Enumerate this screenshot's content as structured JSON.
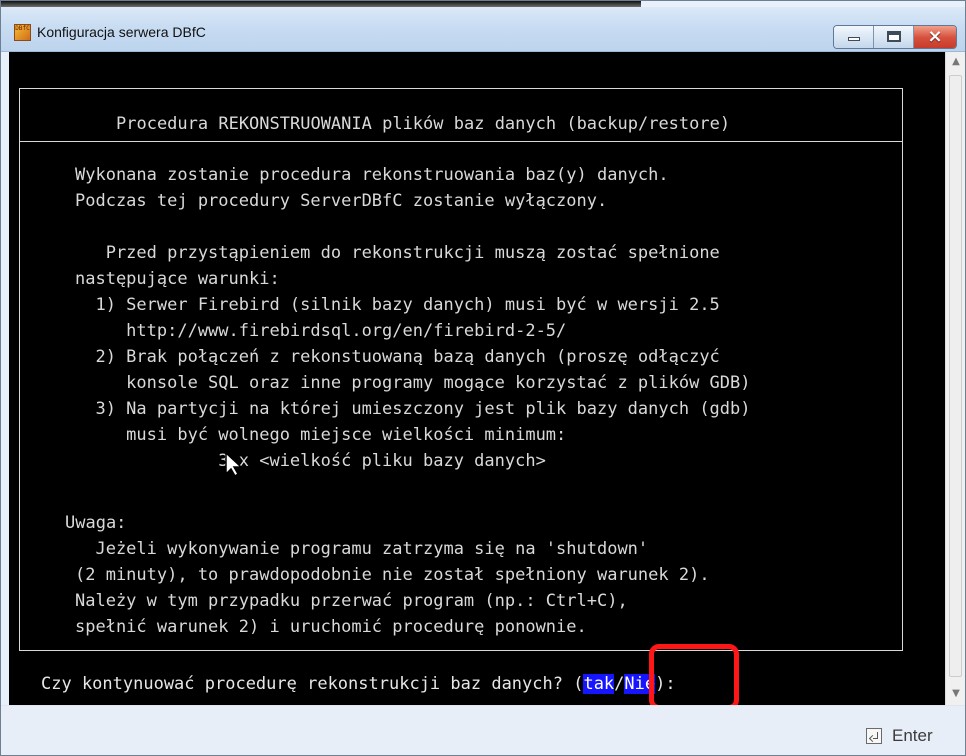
{
  "window": {
    "title": "Konfiguracja serwera DBfC",
    "app_icon_text": "DBfC",
    "icons": {
      "app": "dbfc-app-icon",
      "minimize": "minimize-icon",
      "maximize": "maximize-icon",
      "close": "close-icon",
      "enter": "enter-key-icon",
      "cursor": "mouse-pointer-icon"
    },
    "colors": {
      "console_background": "#000000",
      "console_text": "#d9d9d9",
      "choice_background": "#1515ff",
      "annotation": "#ff1616"
    }
  },
  "console": {
    "heading": "Procedura REKONSTRUOWANIA plików baz danych (backup/restore)",
    "lines": [
      "Wykonana zostanie procedura rekonstruowania baz(y) danych.",
      "Podczas tej procedury ServerDBfC zostanie wyłączony.",
      "",
      "   Przed przystąpieniem do rekonstrukcji muszą zostać spełnione",
      "następujące warunki:",
      "  1) Serwer Firebird (silnik bazy danych) musi być w wersji 2.5",
      "     http://www.firebirdsql.org/en/firebird-2-5/",
      "  2) Brak połączeń z rekonstuowaną bazą danych (proszę odłączyć",
      "     konsole SQL oraz inne programy mogące korzystać z plików GDB)",
      "  3) Na partycji na której umieszczony jest plik bazy danych (gdb)",
      "     musi być wolnego miejsce wielkości minimum:",
      "              3 x <wielkość pliku bazy danych>"
    ],
    "note": {
      "label": "Uwaga:",
      "lines": [
        "  Jeżeli wykonywanie programu zatrzyma się na 'shutdown'",
        "(2 minuty), to prawdopodobnie nie został spełniony warunek 2).",
        "Należy w tym przypadku przerwać program (np.: Ctrl+C),",
        "spełnić warunek 2) i uruchomić procedurę ponownie."
      ]
    },
    "prompt": {
      "before": "Czy kontynuować procedurę rekonstrukcji baz danych? (",
      "yes": "tak",
      "slash": "/",
      "no": "Nie",
      "after": "):"
    }
  },
  "bottom": {
    "enter_label": "Enter"
  }
}
